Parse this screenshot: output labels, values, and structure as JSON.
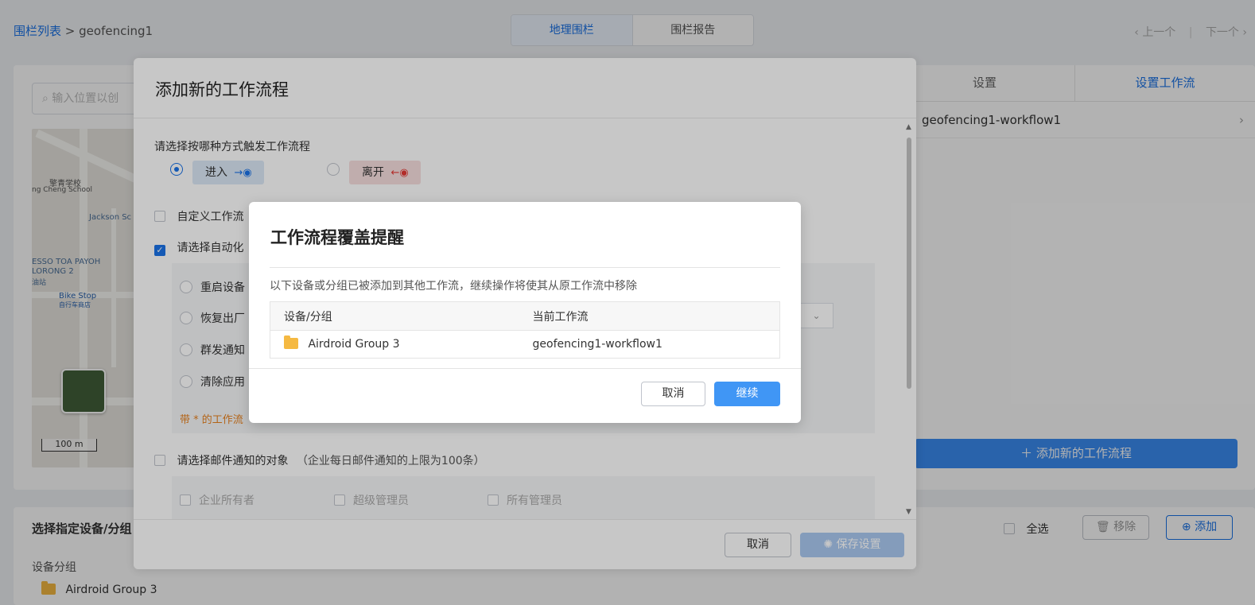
{
  "breadcrumb": {
    "parent": "围栏列表",
    "separator": ">",
    "current": "geofencing1"
  },
  "top_tabs": [
    "地理围栏",
    "围栏报告"
  ],
  "pager": {
    "prev": "上一个",
    "next": "下一个"
  },
  "search": {
    "placeholder": "输入位置以创"
  },
  "map": {
    "labels": [
      "擎青学校",
      "ng Cheng School",
      "Jackson Sc",
      "ESSO TOA PAYOH",
      "LORONG 2",
      "油站",
      "Bike Stop",
      "自行车商店"
    ],
    "scale": "100 m"
  },
  "right_tabs": [
    "设置",
    "设置工作流"
  ],
  "workflow_item": "geofencing1-workflow1",
  "add_workflow_button": "添加新的工作流程",
  "bottom": {
    "title": "选择指定设备/分组",
    "group_label": "设备分组",
    "group_item": "Airdroid Group 3",
    "select_all": "全选",
    "remove_button": "移除",
    "add_button": "添加"
  },
  "dialog_main": {
    "title": "添加新的工作流程",
    "trigger_question": "请选择按哪种方式触发工作流程",
    "enter": "进入",
    "leave": "离开",
    "custom_workflow": "自定义工作流",
    "auto_select": "请选择自动化",
    "options": [
      "重启设备",
      "恢复出厂",
      "群发通知",
      "清除应用"
    ],
    "note": "带 * 的工作流",
    "email_label": "请选择邮件通知的对象",
    "email_hint": "（企业每日邮件通知的上限为100条）",
    "email_targets": [
      "企业所有者",
      "超级管理员",
      "所有管理员"
    ],
    "cancel": "取消",
    "save": "保存设置"
  },
  "dialog_confirm": {
    "title": "工作流程覆盖提醒",
    "message": "以下设备或分组已被添加到其他工作流，继续操作将使其从原工作流中移除",
    "columns": [
      "设备/分组",
      "当前工作流"
    ],
    "rows": [
      {
        "device": "Airdroid Group 3",
        "workflow": "geofencing1-workflow1"
      }
    ],
    "cancel": "取消",
    "continue": "继续"
  },
  "colors": {
    "primary": "#1a73e8",
    "continue_button": "#4096f5",
    "note": "#e6801e",
    "folder": "#f5b942"
  }
}
